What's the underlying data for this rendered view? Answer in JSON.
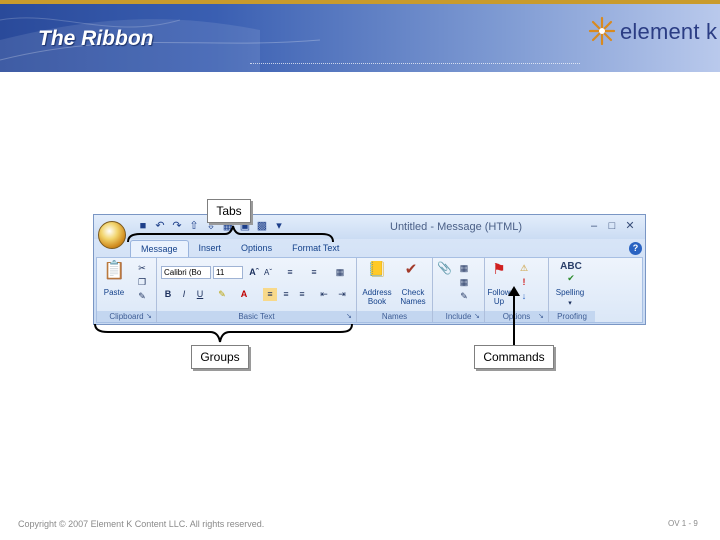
{
  "slide": {
    "title": "The Ribbon",
    "logo_text": "element k",
    "footer": "Copyright © 2007 Element K Content LLC. All rights reserved.",
    "page_number": "OV 1 - 9"
  },
  "callouts": {
    "tabs": "Tabs",
    "groups": "Groups",
    "commands": "Commands"
  },
  "window": {
    "title": "Untitled - Message (HTML)",
    "tabs": [
      "Message",
      "Insert",
      "Options",
      "Format Text"
    ],
    "groups": {
      "clipboard": "Clipboard",
      "basic_text": "Basic Text",
      "names": "Names",
      "include": "Include",
      "options": "Options",
      "proofing": "Proofing"
    },
    "commands": {
      "paste": "Paste",
      "font_name": "Calibri (Bo",
      "font_size": "11",
      "address_book_1": "Address",
      "address_book_2": "Book",
      "check_names_1": "Check",
      "check_names_2": "Names",
      "follow_up_1": "Follow",
      "follow_up_2": "Up",
      "spelling": "Spelling",
      "abc": "ABC"
    }
  },
  "colors": {
    "banner": "#3a5fb2",
    "accent_strip": "#c99b2c",
    "ribbon_text": "#15428b"
  }
}
